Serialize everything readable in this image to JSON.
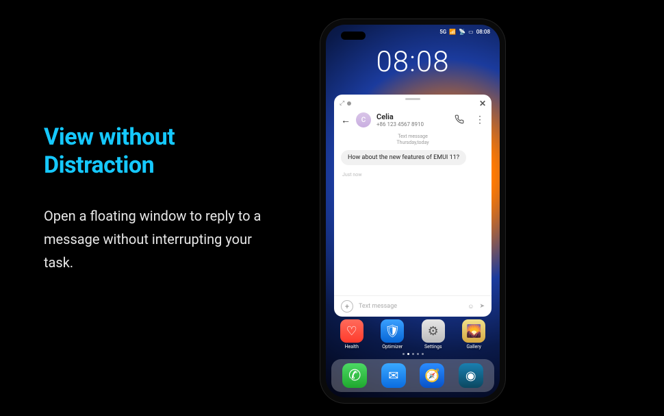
{
  "marketing": {
    "title_line1": "View without",
    "title_line2": "Distraction",
    "desc": "Open a floating window to reply to a message without interrupting your task."
  },
  "statusbar": {
    "network_label": "5G",
    "time": "08:08"
  },
  "homescreen": {
    "clock": "08:08",
    "apps_row": [
      {
        "name": "health",
        "label": "Health",
        "glyph": "♡"
      },
      {
        "name": "optimizer",
        "label": "Optimizer",
        "glyph": "🛡"
      },
      {
        "name": "settings",
        "label": "Settings",
        "glyph": "⚙"
      },
      {
        "name": "gallery",
        "label": "Gallery",
        "glyph": "🌄"
      }
    ],
    "dock": [
      {
        "name": "phone",
        "glyph": "✆"
      },
      {
        "name": "messages",
        "glyph": "✉"
      },
      {
        "name": "browser",
        "glyph": "🧭"
      },
      {
        "name": "camera",
        "glyph": "◉"
      }
    ]
  },
  "floating_window": {
    "contact_name": "Celia",
    "contact_initial": "C",
    "contact_number": "+86 123 4567 8910",
    "thread_type": "Text message",
    "thread_date": "Thursday,today",
    "bubble_text": "How about the new features of EMUI 11?",
    "timestamp": "Just now",
    "input_placeholder": "Text message"
  }
}
